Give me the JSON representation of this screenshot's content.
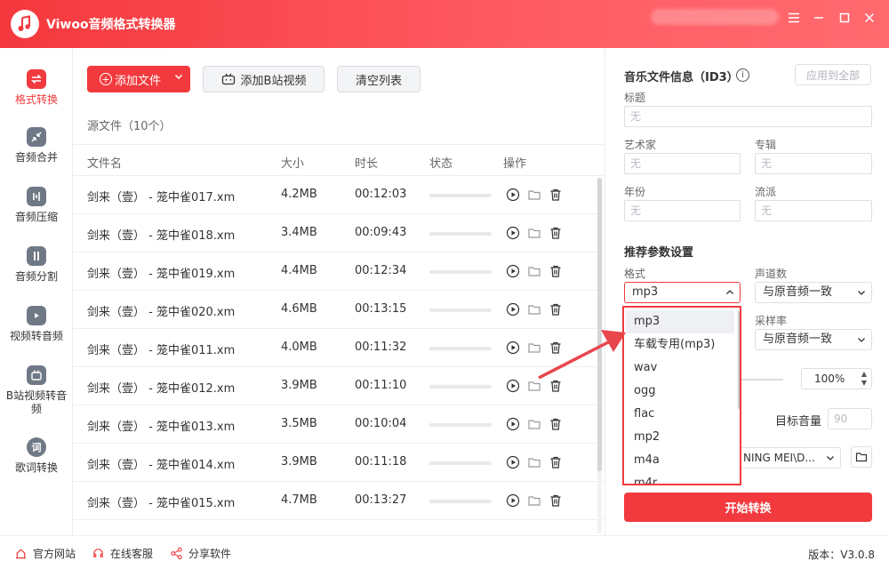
{
  "app": {
    "title": "Viwoo音频格式转换器"
  },
  "sidebar": {
    "items": [
      {
        "label": "格式转换",
        "active": true,
        "icon": "convert-icon"
      },
      {
        "label": "音频合并",
        "icon": "merge-icon"
      },
      {
        "label": "音频压缩",
        "icon": "compress-icon"
      },
      {
        "label": "音频分割",
        "icon": "split-icon"
      },
      {
        "label": "视频转音频",
        "icon": "video-icon"
      },
      {
        "label": "B站视频转音频",
        "icon": "bilibili-icon"
      },
      {
        "label": "歌词转换",
        "icon": "lyrics-icon"
      }
    ]
  },
  "toolbar": {
    "add_file": "添加文件",
    "add_bilibili": "添加B站视频",
    "clear_list": "清空列表"
  },
  "source_count": "源文件（10个）",
  "table": {
    "headers": {
      "name": "文件名",
      "size": "大小",
      "duration": "时长",
      "status": "状态",
      "ops": "操作"
    },
    "rows": [
      {
        "name": "剑来（壹） - 笼中雀017.xm",
        "size": "4.2MB",
        "duration": "00:12:03"
      },
      {
        "name": "剑来（壹） - 笼中雀018.xm",
        "size": "3.4MB",
        "duration": "00:09:43"
      },
      {
        "name": "剑来（壹） - 笼中雀019.xm",
        "size": "4.4MB",
        "duration": "00:12:34"
      },
      {
        "name": "剑来（壹） - 笼中雀020.xm",
        "size": "4.6MB",
        "duration": "00:13:15"
      },
      {
        "name": "剑来（壹） - 笼中雀011.xm",
        "size": "4.0MB",
        "duration": "00:11:32"
      },
      {
        "name": "剑来（壹） - 笼中雀012.xm",
        "size": "3.9MB",
        "duration": "00:11:10"
      },
      {
        "name": "剑来（壹） - 笼中雀013.xm",
        "size": "3.5MB",
        "duration": "00:10:04"
      },
      {
        "name": "剑来（壹） - 笼中雀014.xm",
        "size": "3.9MB",
        "duration": "00:11:18"
      },
      {
        "name": "剑来（壹） - 笼中雀015.xm",
        "size": "4.7MB",
        "duration": "00:13:27"
      }
    ]
  },
  "id3": {
    "title": "音乐文件信息（ID3）",
    "apply_all": "应用到全部",
    "fields": {
      "title_label": "标题",
      "title_value": "无",
      "artist_label": "艺术家",
      "artist_value": "无",
      "album_label": "专辑",
      "album_value": "无",
      "year_label": "年份",
      "year_value": "无",
      "genre_label": "流派",
      "genre_value": "无"
    }
  },
  "params": {
    "title": "推荐参数设置",
    "format_label": "格式",
    "format_value": "mp3",
    "channels_label": "声道数",
    "channels_value": "与原音频一致",
    "samplerate_label": "采样率",
    "samplerate_value": "与原音频一致",
    "volume_pct": "100%",
    "target_volume_label": "目标音量",
    "target_volume_value": "90",
    "output_path": "NING MEI\\D...",
    "start_button": "开始转换"
  },
  "format_dropdown": {
    "options": [
      "mp3",
      "车载专用(mp3)",
      "wav",
      "ogg",
      "flac",
      "mp2",
      "m4a",
      "m4r"
    ],
    "selected": "mp3"
  },
  "footer": {
    "website": "官方网站",
    "support": "在线客服",
    "share": "分享软件",
    "version": "版本：V3.0.8"
  },
  "colors": {
    "accent": "#f23a3e",
    "nav_icon": "#6f7986"
  }
}
